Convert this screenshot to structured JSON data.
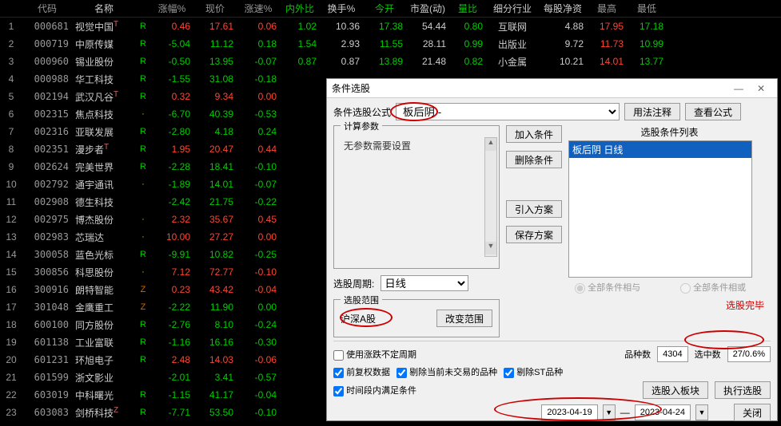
{
  "headers": [
    "代码",
    "名称",
    "涨幅%",
    "现价",
    "涨速%",
    "内外比",
    "换手%",
    "今开",
    "市盈(动)",
    "量比",
    "细分行业",
    "每股净资",
    "最高",
    "最低"
  ],
  "rows": [
    {
      "idx": 1,
      "code": "000681",
      "name": "视觉中国",
      "mark": "T",
      "rmark": "R",
      "pct": "0.46",
      "price": "17.61",
      "speed": "0.06",
      "ratio": "1.02",
      "turn": "10.36",
      "open": "17.38",
      "pe": "54.44",
      "vr": "0.80",
      "ind": "互联网",
      "nav": "4.88",
      "high": "17.95",
      "low": "17.18",
      "pc": "red",
      "oc": "green",
      "vc": "green"
    },
    {
      "idx": 2,
      "code": "000719",
      "name": "中原传媒",
      "mark": "",
      "rmark": "R",
      "pct": "-5.04",
      "price": "11.12",
      "speed": "0.18",
      "ratio": "1.54",
      "turn": "2.93",
      "open": "11.55",
      "pe": "28.11",
      "vr": "0.99",
      "ind": "出版业",
      "nav": "9.72",
      "high": "11.73",
      "low": "10.99",
      "pc": "green",
      "oc": "green",
      "vc": "green"
    },
    {
      "idx": 3,
      "code": "000960",
      "name": "锡业股份",
      "mark": "",
      "rmark": "R",
      "pct": "-0.50",
      "price": "13.95",
      "speed": "-0.07",
      "ratio": "0.87",
      "turn": "0.87",
      "open": "13.89",
      "pe": "21.48",
      "vr": "0.82",
      "ind": "小金属",
      "nav": "10.21",
      "high": "14.01",
      "low": "13.77",
      "pc": "green",
      "oc": "green",
      "vc": "green"
    },
    {
      "idx": 4,
      "code": "000988",
      "name": "华工科技",
      "mark": "",
      "rmark": "R",
      "pct": "-1.55",
      "price": "31.08",
      "speed": "-0.18",
      "ratio": "",
      "turn": "",
      "open": "",
      "pe": "",
      "vr": "",
      "ind": "",
      "nav": "",
      "high": "",
      "low": "",
      "pc": "green",
      "oc": "",
      "vc": ""
    },
    {
      "idx": 5,
      "code": "002194",
      "name": "武汉凡谷",
      "mark": "T",
      "rmark": "R",
      "pct": "0.32",
      "price": "9.34",
      "speed": "0.00",
      "ratio": "",
      "turn": "",
      "open": "",
      "pe": "",
      "vr": "",
      "ind": "",
      "nav": "",
      "high": "",
      "low": "",
      "pc": "red",
      "oc": "",
      "vc": ""
    },
    {
      "idx": 6,
      "code": "002315",
      "name": "焦点科技",
      "mark": "",
      "rmark": "·",
      "pct": "-6.70",
      "price": "40.39",
      "speed": "-0.53",
      "ratio": "",
      "turn": "",
      "open": "",
      "pe": "",
      "vr": "",
      "ind": "",
      "nav": "",
      "high": "",
      "low": "",
      "pc": "green",
      "oc": "",
      "vc": ""
    },
    {
      "idx": 7,
      "code": "002316",
      "name": "亚联发展",
      "mark": "",
      "rmark": "R",
      "pct": "-2.80",
      "price": "4.18",
      "speed": "0.24",
      "ratio": "",
      "turn": "",
      "open": "",
      "pe": "",
      "vr": "",
      "ind": "",
      "nav": "",
      "high": "",
      "low": "",
      "pc": "green",
      "oc": "",
      "vc": ""
    },
    {
      "idx": 8,
      "code": "002351",
      "name": "漫步者",
      "mark": "T",
      "rmark": "R",
      "pct": "1.95",
      "price": "20.47",
      "speed": "0.44",
      "ratio": "",
      "turn": "",
      "open": "",
      "pe": "",
      "vr": "",
      "ind": "",
      "nav": "",
      "high": "",
      "low": "",
      "pc": "red",
      "oc": "",
      "vc": ""
    },
    {
      "idx": 9,
      "code": "002624",
      "name": "完美世界",
      "mark": "",
      "rmark": "R",
      "pct": "-2.28",
      "price": "18.41",
      "speed": "-0.10",
      "ratio": "",
      "turn": "",
      "open": "",
      "pe": "",
      "vr": "",
      "ind": "",
      "nav": "",
      "high": "",
      "low": "",
      "pc": "green",
      "oc": "",
      "vc": ""
    },
    {
      "idx": 10,
      "code": "002792",
      "name": "通宇通讯",
      "mark": "",
      "rmark": "·",
      "pct": "-1.89",
      "price": "14.01",
      "speed": "-0.07",
      "ratio": "",
      "turn": "",
      "open": "",
      "pe": "",
      "vr": "",
      "ind": "",
      "nav": "",
      "high": "",
      "low": "",
      "pc": "green",
      "oc": "",
      "vc": ""
    },
    {
      "idx": 11,
      "code": "002908",
      "name": "德生科技",
      "mark": "",
      "rmark": "",
      "pct": "-2.42",
      "price": "21.75",
      "speed": "-0.22",
      "ratio": "",
      "turn": "",
      "open": "",
      "pe": "",
      "vr": "",
      "ind": "",
      "nav": "",
      "high": "",
      "low": "",
      "pc": "green",
      "oc": "",
      "vc": ""
    },
    {
      "idx": 12,
      "code": "002975",
      "name": "博杰股份",
      "mark": "",
      "rmark": "·",
      "pct": "2.32",
      "price": "35.67",
      "speed": "0.45",
      "ratio": "",
      "turn": "",
      "open": "",
      "pe": "",
      "vr": "",
      "ind": "",
      "nav": "",
      "high": "",
      "low": "",
      "pc": "red",
      "oc": "",
      "vc": ""
    },
    {
      "idx": 13,
      "code": "002983",
      "name": "芯瑞达",
      "mark": "",
      "rmark": "·",
      "pct": "10.00",
      "price": "27.27",
      "speed": "0.00",
      "ratio": "",
      "turn": "",
      "open": "",
      "pe": "",
      "vr": "",
      "ind": "",
      "nav": "",
      "high": "",
      "low": "",
      "pc": "red",
      "oc": "",
      "vc": ""
    },
    {
      "idx": 14,
      "code": "300058",
      "name": "蓝色光标",
      "mark": "",
      "rmark": "R",
      "pct": "-9.91",
      "price": "10.82",
      "speed": "-0.25",
      "ratio": "",
      "turn": "",
      "open": "",
      "pe": "",
      "vr": "",
      "ind": "",
      "nav": "",
      "high": "",
      "low": "",
      "pc": "green",
      "oc": "",
      "vc": ""
    },
    {
      "idx": 15,
      "code": "300856",
      "name": "科思股份",
      "mark": "",
      "rmark": "·",
      "pct": "7.12",
      "price": "72.77",
      "speed": "-0.10",
      "ratio": "",
      "turn": "",
      "open": "",
      "pe": "",
      "vr": "",
      "ind": "",
      "nav": "",
      "high": "",
      "low": "",
      "pc": "red",
      "oc": "",
      "vc": ""
    },
    {
      "idx": 16,
      "code": "300916",
      "name": "朗特智能",
      "mark": "",
      "rmark": "Z",
      "pct": "0.23",
      "price": "43.42",
      "speed": "-0.04",
      "ratio": "",
      "turn": "",
      "open": "",
      "pe": "",
      "vr": "",
      "ind": "",
      "nav": "",
      "high": "",
      "low": "",
      "pc": "red",
      "oc": "",
      "vc": ""
    },
    {
      "idx": 17,
      "code": "301048",
      "name": "金鹰重工",
      "mark": "",
      "rmark": "Z",
      "pct": "-2.22",
      "price": "11.90",
      "speed": "0.00",
      "ratio": "",
      "turn": "",
      "open": "",
      "pe": "",
      "vr": "",
      "ind": "",
      "nav": "",
      "high": "",
      "low": "",
      "pc": "green",
      "oc": "",
      "vc": ""
    },
    {
      "idx": 18,
      "code": "600100",
      "name": "同方股份",
      "mark": "",
      "rmark": "R",
      "pct": "-2.76",
      "price": "8.10",
      "speed": "-0.24",
      "ratio": "",
      "turn": "",
      "open": "",
      "pe": "",
      "vr": "",
      "ind": "",
      "nav": "",
      "high": "",
      "low": "",
      "pc": "green",
      "oc": "",
      "vc": ""
    },
    {
      "idx": 19,
      "code": "601138",
      "name": "工业富联",
      "mark": "",
      "rmark": "R",
      "pct": "-1.16",
      "price": "16.16",
      "speed": "-0.30",
      "ratio": "",
      "turn": "",
      "open": "",
      "pe": "",
      "vr": "",
      "ind": "",
      "nav": "",
      "high": "",
      "low": "",
      "pc": "green",
      "oc": "",
      "vc": ""
    },
    {
      "idx": 20,
      "code": "601231",
      "name": "环旭电子",
      "mark": "",
      "rmark": "R",
      "pct": "2.48",
      "price": "14.03",
      "speed": "-0.06",
      "ratio": "",
      "turn": "",
      "open": "",
      "pe": "",
      "vr": "",
      "ind": "",
      "nav": "",
      "high": "",
      "low": "",
      "pc": "red",
      "oc": "",
      "vc": ""
    },
    {
      "idx": 21,
      "code": "601599",
      "name": "浙文影业",
      "mark": "",
      "rmark": "",
      "pct": "-2.01",
      "price": "3.41",
      "speed": "-0.57",
      "ratio": "",
      "turn": "",
      "open": "",
      "pe": "",
      "vr": "",
      "ind": "",
      "nav": "",
      "high": "",
      "low": "",
      "pc": "green",
      "oc": "",
      "vc": ""
    },
    {
      "idx": 22,
      "code": "603019",
      "name": "中科曙光",
      "mark": "",
      "rmark": "R",
      "pct": "-1.15",
      "price": "41.17",
      "speed": "-0.04",
      "ratio": "",
      "turn": "",
      "open": "",
      "pe": "",
      "vr": "",
      "ind": "",
      "nav": "",
      "high": "",
      "low": "",
      "pc": "green",
      "oc": "",
      "vc": ""
    },
    {
      "idx": 23,
      "code": "603083",
      "name": "剑桥科技",
      "mark": "Z",
      "rmark": "R",
      "pct": "-7.71",
      "price": "53.50",
      "speed": "-0.10",
      "ratio": "",
      "turn": "",
      "open": "",
      "pe": "",
      "vr": "",
      "ind": "",
      "nav": "",
      "high": "",
      "low": "",
      "pc": "green",
      "oc": "",
      "vc": ""
    }
  ],
  "dialog": {
    "title": "条件选股",
    "formula_label": "条件选股公式",
    "formula_value": "板后阴",
    "formula_dash": "-",
    "usage_btn": "用法注释",
    "view_btn": "查看公式",
    "param_title": "计算参数",
    "param_text": "无参数需要设置",
    "add_cond": "加入条件",
    "del_cond": "删除条件",
    "import_scheme": "引入方案",
    "save_scheme": "保存方案",
    "cond_list_title": "选股条件列表",
    "cond_item": "板后阴  日线",
    "period_label": "选股周期:",
    "period_value": "日线",
    "scope_title": "选股范围",
    "scope_value": "沪深A股",
    "change_scope": "改变范围",
    "radio_and": "全部条件相与",
    "radio_or": "全部条件相或",
    "done_text": "选股完毕",
    "use_var_period": "使用涨跌不定周期",
    "stock_count_label": "品种数",
    "stock_count": "4304",
    "hit_label": "选中数",
    "hit_value": "27/0.6%",
    "pre_adjust": "前复权数据",
    "remove_nontrade": "剔除当前未交易的品种",
    "remove_st": "剔除ST品种",
    "time_range": "时间段内满足条件",
    "to_block": "选股入板块",
    "run_select": "执行选股",
    "date_from": "2023-04-19",
    "date_to": "2023-04-24",
    "close_btn": "关闭"
  }
}
